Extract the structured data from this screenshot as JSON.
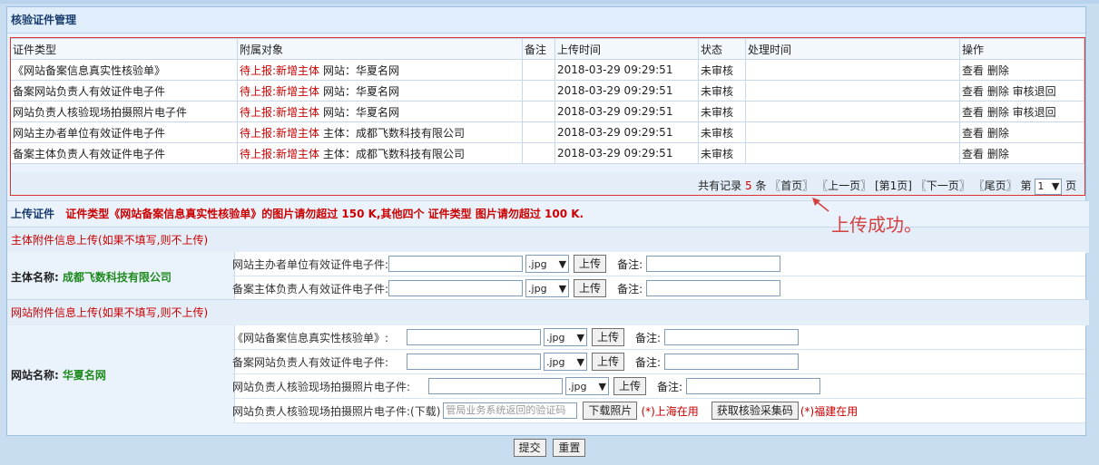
{
  "panel": {
    "title": "核验证件管理"
  },
  "table": {
    "headers": [
      "证件类型",
      "附属对象",
      "备注",
      "上传时间",
      "状态",
      "处理时间",
      "操作"
    ],
    "rows": [
      {
        "type": "《网站备案信息真实性核验单》",
        "status_tag": "待上报:新增主体",
        "object": "网站：华夏名网",
        "remark": "",
        "time": "2018-03-29 09:29:51",
        "state": "未审核",
        "handled": "",
        "ops": "查看 删除"
      },
      {
        "type": "备案网站负责人有效证件电子件",
        "status_tag": "待上报:新增主体",
        "object": "网站：华夏名网",
        "remark": "",
        "time": "2018-03-29 09:29:51",
        "state": "未审核",
        "handled": "",
        "ops": "查看 删除 审核退回"
      },
      {
        "type": "网站负责人核验现场拍摄照片电子件",
        "status_tag": "待上报:新增主体",
        "object": "网站：华夏名网",
        "remark": "",
        "time": "2018-03-29 09:29:51",
        "state": "未审核",
        "handled": "",
        "ops": "查看 删除 审核退回"
      },
      {
        "type": "网站主办者单位有效证件电子件",
        "status_tag": "待上报:新增主体",
        "object": "主体：成都飞数科技有限公司",
        "remark": "",
        "time": "2018-03-29 09:29:51",
        "state": "未审核",
        "handled": "",
        "ops": "查看 删除"
      },
      {
        "type": "备案主体负责人有效证件电子件",
        "status_tag": "待上报:新增主体",
        "object": "主体：成都飞数科技有限公司",
        "remark": "",
        "time": "2018-03-29 09:29:51",
        "state": "未审核",
        "handled": "",
        "ops": "查看 删除"
      }
    ]
  },
  "pager": {
    "prefix": "共有记录",
    "count": "5",
    "unit": "条",
    "first": "〖首页〗",
    "prev": "〖上一页〗",
    "current": "[第1页]",
    "next": "〖下一页〗",
    "last": "〖尾页〗",
    "goto_prefix": "第",
    "page_value": "1",
    "goto_suffix": "页"
  },
  "upload": {
    "title": "上传证件",
    "note": "证件类型《网站备案信息真实性核验单》的图片请勿超过 150 K,其他四个 证件类型 图片请勿超过 100 K."
  },
  "subject_section": {
    "heading": "主体附件信息上传(如果不填写,则不上传)",
    "label": "主体名称:",
    "name": "成都飞数科技有限公司",
    "rows": [
      {
        "label": "网站主办者单位有效证件电子件:",
        "ext": ".jpg",
        "upload": "上传",
        "remark_label": "备注:"
      },
      {
        "label": "备案主体负责人有效证件电子件:",
        "ext": ".jpg",
        "upload": "上传",
        "remark_label": "备注:"
      }
    ]
  },
  "site_section": {
    "heading": "网站附件信息上传(如果不填写,则不上传)",
    "label": "网站名称:",
    "name": "华夏名网",
    "rows": [
      {
        "label": "《网站备案信息真实性核验单》:",
        "ext": ".jpg",
        "upload": "上传",
        "remark_label": "备注:"
      },
      {
        "label": "备案网站负责人有效证件电子件:",
        "ext": ".jpg",
        "upload": "上传",
        "remark_label": "备注:"
      },
      {
        "label": "网站负责人核验现场拍摄照片电子件:",
        "ext": ".jpg",
        "upload": "上传",
        "remark_label": "备注:"
      }
    ],
    "photo_row": {
      "label": "网站负责人核验现场拍摄照片电子件:(下载)",
      "placeholder": "管局业务系统返回的验证码",
      "download": "下载照片",
      "shanghai": "(*)上海在用",
      "fetch": "获取核验采集码",
      "fujian": "(*)福建在用"
    }
  },
  "buttons": {
    "submit": "提交",
    "reset": "重置"
  },
  "annotation": {
    "text": "上传成功。",
    "color": "#d34040"
  }
}
